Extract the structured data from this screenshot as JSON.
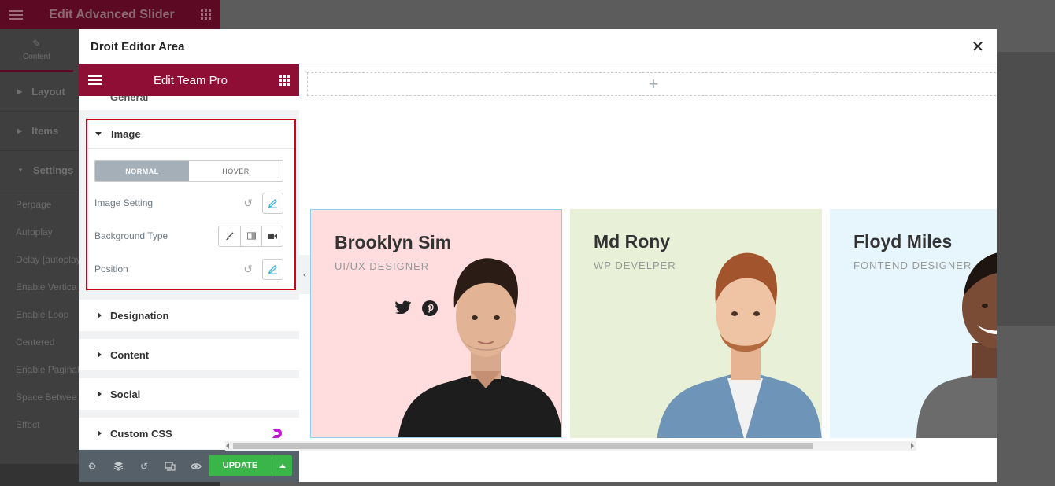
{
  "background_editor": {
    "title": "Edit Advanced Slider",
    "tab_label": "Content",
    "sections": [
      "Layout",
      "Items",
      "Settings"
    ],
    "rows": [
      "Perpage",
      "Autoplay",
      "Delay [autoplay",
      "Enable Vertica",
      "Enable Loop",
      "Centered",
      "Enable Paginat",
      "Space Betwee",
      "Effect"
    ]
  },
  "modal": {
    "title": "Droit Editor Area",
    "close_icon": "close-icon"
  },
  "panel": {
    "title": "Edit Team Pro",
    "sections": {
      "general": "General",
      "image": "Image",
      "designation": "Designation",
      "content": "Content",
      "social": "Social",
      "custom_css": "Custom CSS"
    },
    "image_tabs": {
      "normal": "NORMAL",
      "hover": "HOVER"
    },
    "controls": {
      "image_setting": "Image Setting",
      "background_type": "Background Type",
      "position": "Position"
    },
    "update_label": "UPDATE",
    "highlight_color": "#d0021b",
    "header_color": "#8e0e36"
  },
  "canvas": {
    "add_label": "+",
    "cards": [
      {
        "name": "Brooklyn Sim",
        "role": "UI/UX DESIGNER",
        "bg": "#ffdcdd"
      },
      {
        "name": "Md Rony",
        "role": "WP DEVELPER",
        "bg": "#e8f0d8"
      },
      {
        "name": "Floyd Miles",
        "role": "FONTEND DESIGNER",
        "bg": "#e6f6fc"
      }
    ]
  }
}
